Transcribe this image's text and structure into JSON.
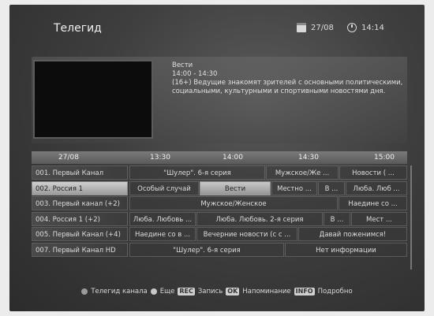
{
  "header": {
    "title": "Телегид",
    "date": "27/08",
    "time": "14:14"
  },
  "program_info": {
    "channel": "Вести",
    "time_range": "14:00 - 14:30",
    "description": "(16+) Ведущие знакомят зрителей с основными политическими, социальными, культурными и спортивными новостями дня."
  },
  "timeline": {
    "date": "27/08",
    "marks": [
      "13:30",
      "14:00",
      "14:30",
      "15:00"
    ]
  },
  "channels": [
    {
      "name": "001. Первый Канал",
      "selected": false,
      "programs": [
        {
          "title": "\"Шулер\". 6-я серия"
        },
        {
          "title": "Мужское/Же ..."
        },
        {
          "title": "Новости ( ..."
        }
      ]
    },
    {
      "name": "002. Россия 1",
      "selected": true,
      "programs": [
        {
          "title": "Особый случай"
        },
        {
          "title": "Вести",
          "highlighted": true
        },
        {
          "title": "Местно ..."
        },
        {
          "title": "В ..."
        },
        {
          "title": "Люба. Люб ..."
        }
      ]
    },
    {
      "name": "003. Первый канал (+2)",
      "selected": false,
      "programs": [
        {
          "title": "Мужское/Женское"
        },
        {
          "title": "Наедине со ..."
        }
      ]
    },
    {
      "name": "004. Россия 1 (+2)",
      "selected": false,
      "programs": [
        {
          "title": "Люба. Любовь ..."
        },
        {
          "title": "Люба. Любовь. 2-я серия"
        },
        {
          "title": "В ..."
        },
        {
          "title": "Мест ..."
        }
      ]
    },
    {
      "name": "005. Первый Канал (+4)",
      "selected": false,
      "programs": [
        {
          "title": "Наедине со в ..."
        },
        {
          "title": "Вечерние новости (с с ..."
        },
        {
          "title": "Давай поженимся!"
        }
      ]
    },
    {
      "name": "007. Первый Канал HD",
      "selected": false,
      "programs": [
        {
          "title": "\"Шулер\". 6-я серия"
        },
        {
          "title": "Нет информации"
        }
      ]
    }
  ],
  "footer": {
    "channel_guide": "Телегид канала",
    "more": "Еще",
    "rec_key": "REC",
    "record": "Запись",
    "ok_key": "OK",
    "reminder": "Напоминание",
    "info_key": "INFO",
    "details": "Подробно"
  },
  "colors": {
    "background": "#3e3e3e",
    "highlight": "#c8c8c8"
  }
}
